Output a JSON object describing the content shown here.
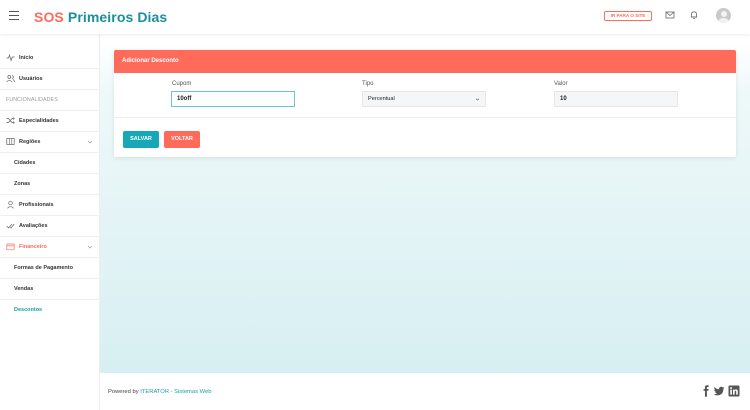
{
  "header": {
    "brand_part1": "SOS",
    "brand_part2": "Primeiros Dias",
    "site_button": "IR PARA O SITE"
  },
  "sidebar": {
    "items": [
      {
        "label": "Início",
        "icon": "activity-icon"
      },
      {
        "label": "Usuários",
        "icon": "users-icon"
      },
      {
        "section": "FUNCIONALIDADES"
      },
      {
        "label": "Especialidades",
        "icon": "shuffle-icon"
      },
      {
        "label": "Regiões",
        "icon": "map-icon",
        "expandable": true
      },
      {
        "label": "Cidades"
      },
      {
        "label": "Zonas"
      },
      {
        "label": "Profissionais",
        "icon": "user-icon"
      },
      {
        "label": "Avaliações",
        "icon": "check-icon"
      },
      {
        "label": "Financeiro",
        "icon": "wallet-icon",
        "expandable": true,
        "active": true
      },
      {
        "label": "Formas de Pagamento"
      },
      {
        "label": "Vendas"
      },
      {
        "label": "Descontos",
        "current": true
      }
    ]
  },
  "form": {
    "title": "Adicionar Desconto",
    "cupom_label": "Cupom",
    "cupom_value": "10off",
    "tipo_label": "Tipo",
    "tipo_value": "Percentual",
    "valor_label": "Valor",
    "valor_value": "10",
    "save_label": "SALVAR",
    "back_label": "VOLTAR"
  },
  "footer": {
    "powered_prefix": "Powered by ",
    "powered_brand": "ITERATOR - Sistemas Web"
  },
  "colors": {
    "accent": "#ff6b5b",
    "teal": "#1a9ea8",
    "brand_teal": "#1a8f98"
  }
}
